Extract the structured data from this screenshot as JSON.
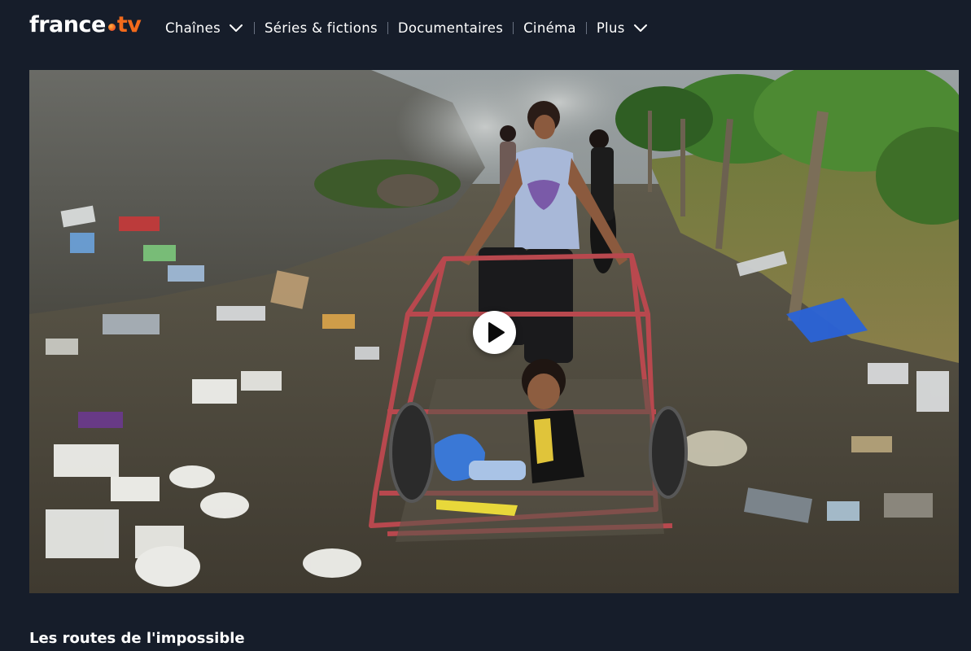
{
  "brand": {
    "logo_main": "france",
    "logo_tv": "tv",
    "accent_color": "#f26a1b"
  },
  "nav": {
    "items": [
      {
        "label": "Chaînes",
        "has_dropdown": true
      },
      {
        "label": "Séries & fictions",
        "has_dropdown": false
      },
      {
        "label": "Documentaires",
        "has_dropdown": false
      },
      {
        "label": "Cinéma",
        "has_dropdown": false
      },
      {
        "label": "Plus",
        "has_dropdown": true
      }
    ]
  },
  "hero": {
    "image_alt": "",
    "play_icon": "play-icon"
  },
  "program": {
    "title": "Les routes de l'impossible"
  }
}
